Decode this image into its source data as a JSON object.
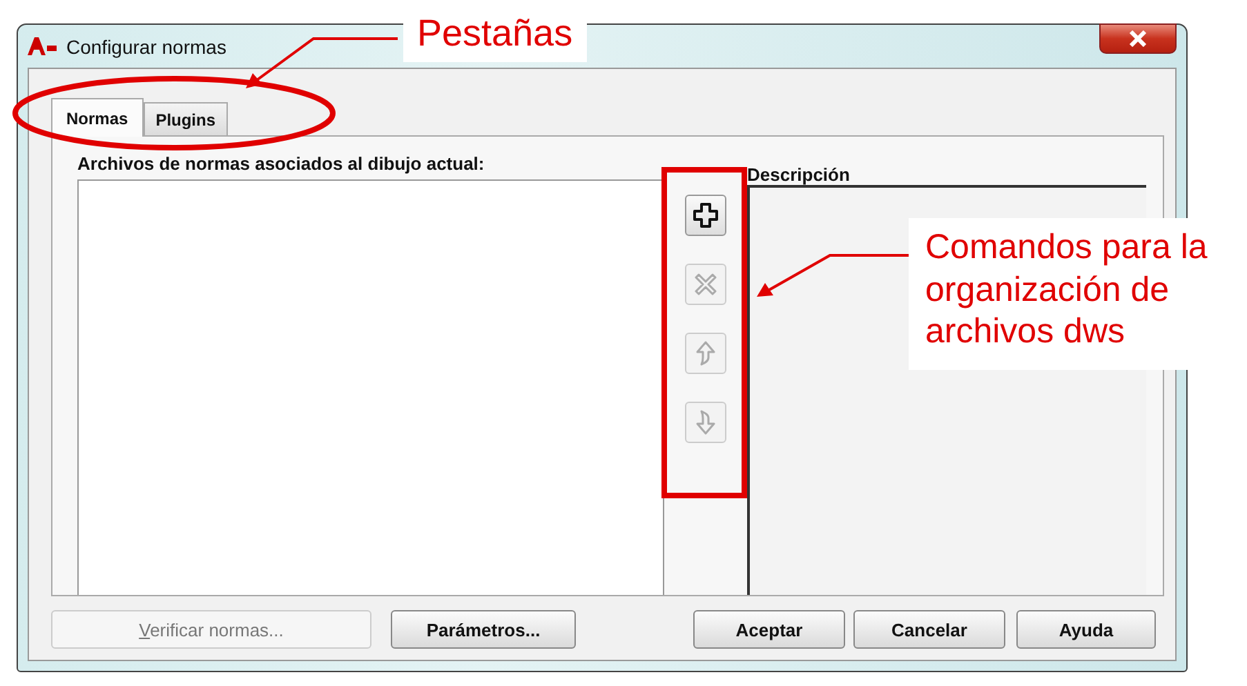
{
  "window": {
    "title": "Configurar normas"
  },
  "tabs": [
    {
      "label": "Normas",
      "selected": true
    },
    {
      "label": "Plugins",
      "selected": false
    }
  ],
  "files_list": {
    "label": "Archivos de normas asociados al dibujo actual:"
  },
  "commands": [
    {
      "kind": "add",
      "disabled": false
    },
    {
      "kind": "remove",
      "disabled": true
    },
    {
      "kind": "up",
      "disabled": true
    },
    {
      "kind": "down",
      "disabled": true
    }
  ],
  "description": {
    "header": "Descripción"
  },
  "buttons": [
    {
      "label": "Verificar normas...",
      "disabled": true,
      "underline_first": true
    },
    {
      "label": "Parámetros...",
      "disabled": false,
      "underline_first": false
    },
    {
      "label": "Aceptar",
      "disabled": false,
      "underline_first": false
    },
    {
      "label": "Cancelar",
      "disabled": false,
      "underline_first": false
    },
    {
      "label": "Ayuda",
      "disabled": false,
      "underline_first": false
    }
  ],
  "annotations": [
    {
      "kind": "tabs",
      "text": "Pestañas"
    },
    {
      "kind": "commands",
      "text": "Comandos para la organización de archivos dws"
    }
  ]
}
